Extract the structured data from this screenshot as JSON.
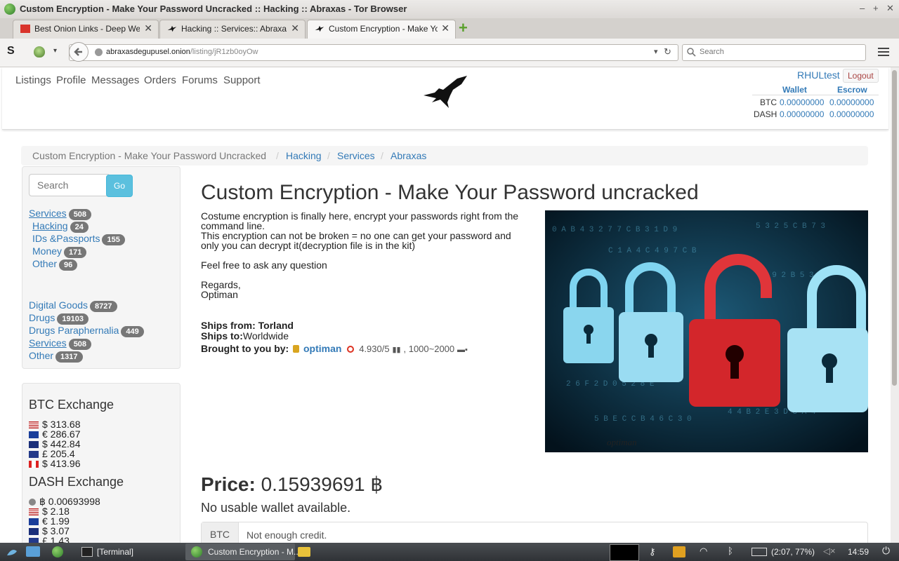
{
  "window": {
    "title": "Custom Encryption - Make Your Password Uncracked :: Hacking :: Abraxas - Tor Browser",
    "min": "–",
    "max": "+",
    "close": "✕"
  },
  "tabs": [
    {
      "label": "Best Onion Links - Deep Web",
      "close": "✕"
    },
    {
      "label": "Hacking :: Services:: Abraxas",
      "close": "✕"
    },
    {
      "label": "Custom Encryption - Make Yo...",
      "close": "✕"
    }
  ],
  "new_tab": "+",
  "navbar": {
    "url_host": "abraxasdegupusel.onion",
    "url_path": "/listing/jR1zb0oyOw",
    "search_placeholder": "Search",
    "reload": "↻",
    "dropdown": "▾"
  },
  "site": {
    "nav": [
      "Listings",
      "Profile",
      "Messages",
      "Orders",
      "Forums",
      "Support"
    ],
    "user": "RHULtest",
    "logout": "Logout",
    "wallet": {
      "h_wallet": "Wallet",
      "h_escrow": "Escrow",
      "rows": [
        {
          "cur": "BTC",
          "wallet": "0.00000000",
          "escrow": "0.00000000"
        },
        {
          "cur": "DASH",
          "wallet": "0.00000000",
          "escrow": "0.00000000"
        }
      ]
    }
  },
  "breadcrumb": {
    "current": "Custom Encryption - Make Your Password Uncracked",
    "sep": "/",
    "links": [
      "Hacking",
      "Services",
      "Abraxas"
    ]
  },
  "sidebar": {
    "search_placeholder": "Search",
    "go": "Go",
    "sub": [
      {
        "label": "Services",
        "count": "508"
      },
      {
        "label": "Hacking",
        "count": "24"
      },
      {
        "label": "IDs &Passports",
        "count": "155"
      },
      {
        "label": "Money",
        "count": "171"
      },
      {
        "label": "Other",
        "count": "96"
      }
    ],
    "main": [
      {
        "label": "Digital Goods",
        "count": "8727"
      },
      {
        "label": "Drugs",
        "count": "19103"
      },
      {
        "label": "Drugs Paraphernalia",
        "count": "449"
      },
      {
        "label": "Services",
        "count": "508"
      },
      {
        "label": "Other",
        "count": "1317"
      }
    ],
    "btc_title": "BTC Exchange",
    "btc": [
      "$ 313.68",
      "€ 286.67",
      "$ 442.84",
      "£ 205.4",
      "$ 413.96"
    ],
    "dash_title": "DASH Exchange",
    "dash": [
      "฿ 0.00693998",
      "$ 2.18",
      "€ 1.99",
      "$ 3.07",
      "£ 1.43"
    ]
  },
  "listing": {
    "title": "Custom Encryption - Make Your Password uncracked",
    "desc1": "Costume encryption is finally here, encrypt your passwords right from the command line.",
    "desc2": "This encryption can not be broken = no one can get your password and only you can decrypt it(decryption file is in the kit)",
    "desc3": "Feel free to ask any question",
    "desc4": "Regards,",
    "desc5": "Optiman",
    "ships_from_label": "Ships from:",
    "ships_from": "Torland",
    "ships_to_label": "Ships to:",
    "ships_to": "Worldwide",
    "brought_label": "Brought to you by:",
    "vendor": "optiman",
    "rating": "4.930/5",
    "sales": ", 1000~2000",
    "image_watermark": "optiman",
    "price_label": "Price:",
    "price": "0.15939691 ฿",
    "wallet_note": "No usable wallet available.",
    "pay_cur": "BTC",
    "pay_msg": "Not enough credit."
  },
  "taskbar": {
    "terminal": "[Terminal]",
    "browser": "Custom Encryption - M...",
    "battery": "(2:07, 77%)",
    "clock": "14:59"
  },
  "colors": {
    "link": "#337ab7",
    "badge": "#777777",
    "lock_red": "#d3262b",
    "lock_blue": "#7fd4f0"
  }
}
